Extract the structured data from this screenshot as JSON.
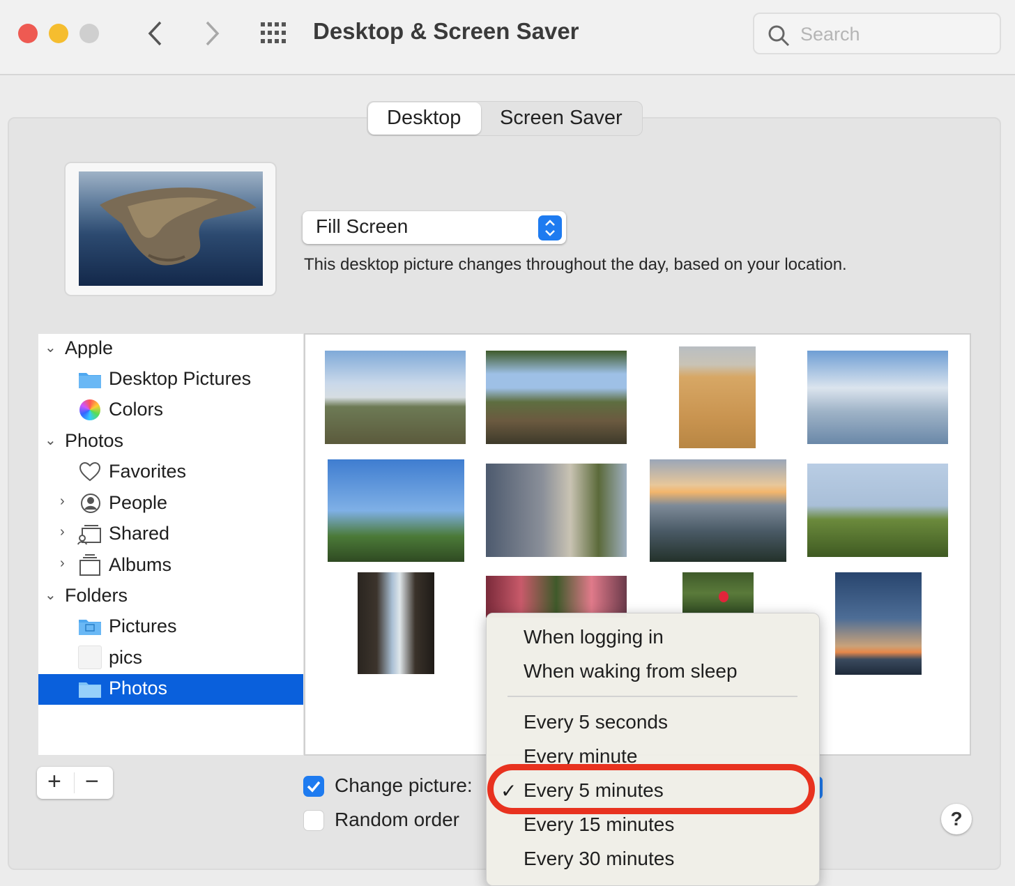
{
  "window": {
    "title": "Desktop & Screen Saver",
    "search_placeholder": "Search",
    "traffic_lights": {
      "close": "#ee5a52",
      "minimize": "#f5bd2f",
      "zoom": "#cfcfcf"
    }
  },
  "tabs": [
    {
      "label": "Desktop",
      "selected": true
    },
    {
      "label": "Screen Saver",
      "selected": false
    }
  ],
  "preview": {
    "fit_option": "Fill Screen",
    "description": "This desktop picture changes throughout the day, based on your location."
  },
  "sidebar": {
    "groups": [
      {
        "label": "Apple",
        "expanded": true,
        "items": [
          {
            "label": "Desktop Pictures",
            "icon": "folder-icon"
          },
          {
            "label": "Colors",
            "icon": "color-wheel-icon"
          }
        ]
      },
      {
        "label": "Photos",
        "expanded": true,
        "items": [
          {
            "label": "Favorites",
            "icon": "heart-icon"
          },
          {
            "label": "People",
            "icon": "person-icon"
          },
          {
            "label": "Shared",
            "icon": "shared-album-icon"
          },
          {
            "label": "Albums",
            "icon": "album-icon"
          }
        ]
      },
      {
        "label": "Folders",
        "expanded": true,
        "items": [
          {
            "label": "Pictures",
            "icon": "pictures-folder-icon"
          },
          {
            "label": "pics",
            "icon": "blank-folder-icon"
          },
          {
            "label": "Photos",
            "icon": "folder-icon",
            "selected": true
          }
        ]
      }
    ]
  },
  "thumbnails": [
    {
      "name": "garden-landscape"
    },
    {
      "name": "vineyard"
    },
    {
      "name": "desert-sand"
    },
    {
      "name": "seagull-bay"
    },
    {
      "name": "water-tower"
    },
    {
      "name": "row-houses"
    },
    {
      "name": "sunset-beach"
    },
    {
      "name": "golden-gate-plants"
    },
    {
      "name": "sea-cave"
    },
    {
      "name": "flowers"
    },
    {
      "name": "balloon-park"
    },
    {
      "name": "ocean-sunset"
    }
  ],
  "bottom": {
    "add_label": "+",
    "remove_label": "−",
    "change_picture_label": "Change picture:",
    "change_picture_checked": true,
    "random_order_label": "Random order",
    "random_order_checked": false,
    "help_label": "?"
  },
  "interval_menu": {
    "group1": [
      "When logging in",
      "When waking from sleep"
    ],
    "group2": [
      "Every 5 seconds",
      "Every minute",
      "Every 5 minutes",
      "Every 15 minutes",
      "Every 30 minutes"
    ],
    "selected": "Every 5 minutes",
    "checkmark": "✓",
    "highlight_color": "#e8321f"
  },
  "accent_color": "#1e7bf0"
}
